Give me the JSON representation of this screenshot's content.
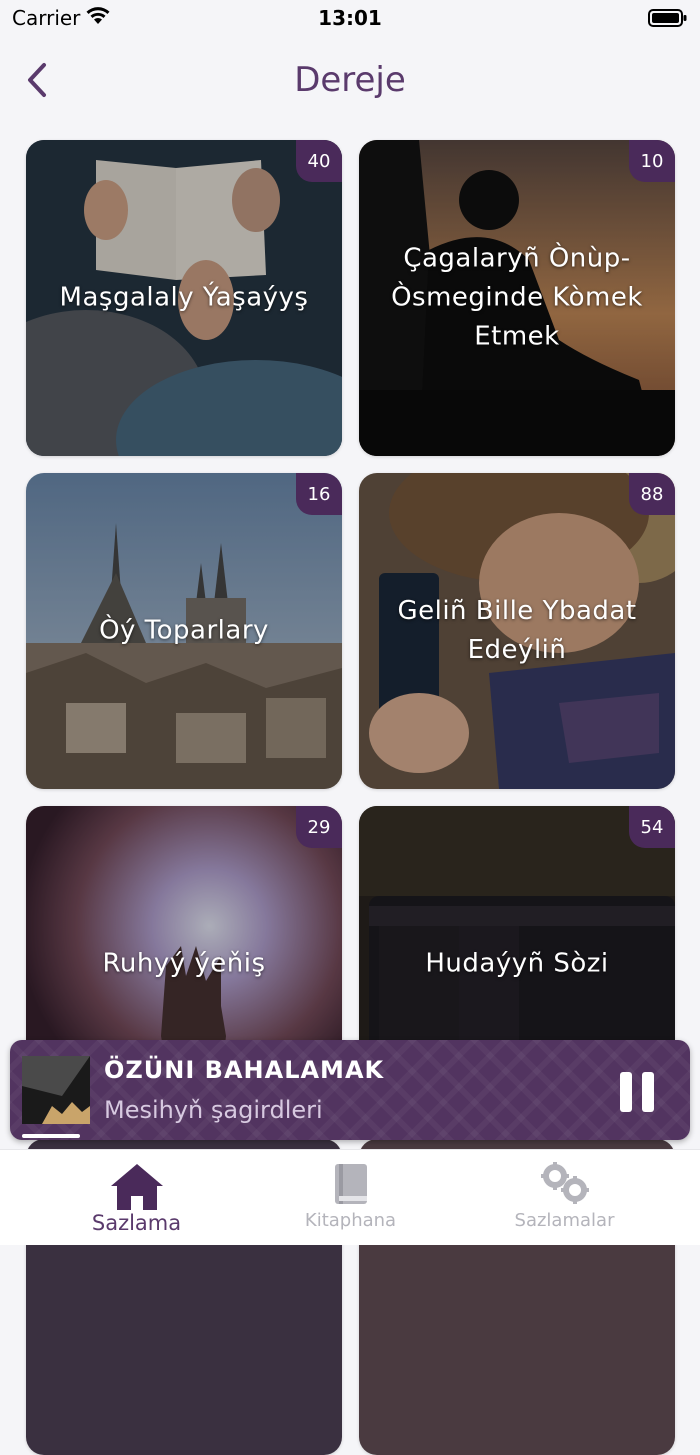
{
  "status_bar": {
    "carrier": "Carrier",
    "time": "13:01"
  },
  "nav": {
    "title": "Dereje",
    "back_icon": "chevron-left-icon"
  },
  "categories": [
    {
      "label": "Maşgalaly Ýaşaýyş",
      "count": "40"
    },
    {
      "label": "Çagalaryñ Ònùp-Òsmeginde Kòmek Etmek",
      "count": "10"
    },
    {
      "label": "Òý Toparlary",
      "count": "16"
    },
    {
      "label": "Geliñ Bille Ybadat Edeýliñ",
      "count": "88"
    },
    {
      "label": "Ruhyý ýeňiş",
      "count": "29"
    },
    {
      "label": "Hudaýyñ Sòzi",
      "count": "54"
    }
  ],
  "player": {
    "title": "ÖZÜNI BAHALAMAK",
    "subtitle": "Mesihyň şagirdleri",
    "control": "pause-icon"
  },
  "tabbar": {
    "tabs": [
      {
        "label": "Sazlama",
        "icon": "home-icon",
        "active": true
      },
      {
        "label": "Kitaphana",
        "icon": "book-icon",
        "active": false
      },
      {
        "label": "Sazlamalar",
        "icon": "gears-icon",
        "active": false
      }
    ]
  },
  "colors": {
    "accent": "#5a3a6c",
    "badge": "#4a2a5a",
    "inactive_tab": "#b4b4bb"
  }
}
